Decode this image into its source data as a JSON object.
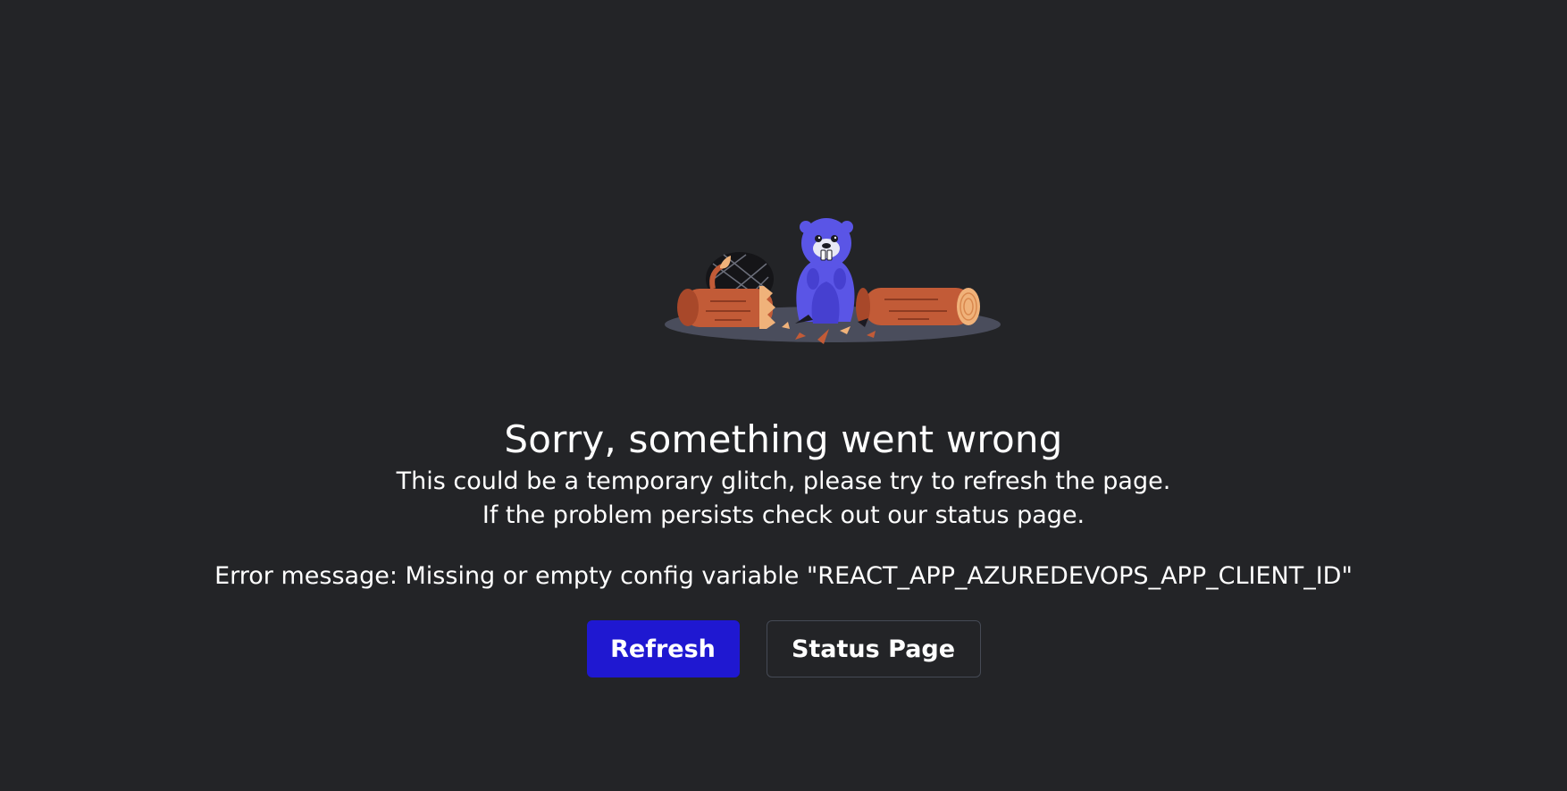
{
  "error_page": {
    "title": "Sorry, something went wrong",
    "subtitle_line1": "This could be a temporary glitch, please try to refresh the page.",
    "subtitle_line2": "If the problem persists check out our status page.",
    "error_message": "Error message: Missing or empty config variable \"REACT_APP_AZUREDEVOPS_APP_CLIENT_ID\"",
    "illustration": "beaver-with-logs-illustration"
  },
  "buttons": {
    "refresh_label": "Refresh",
    "status_page_label": "Status Page"
  },
  "colors": {
    "background": "#232427",
    "primary_button": "#1f18d1",
    "secondary_button_border": "#454a55",
    "beaver": "#5a55e6",
    "wood": "#c4603a"
  }
}
